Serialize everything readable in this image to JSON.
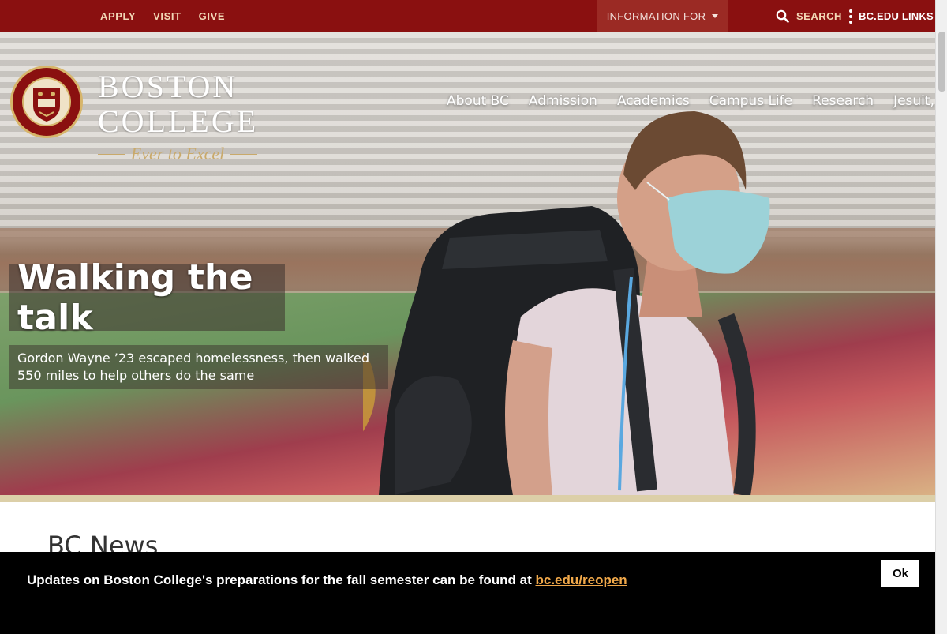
{
  "topbar": {
    "links": [
      "APPLY",
      "VISIT",
      "GIVE"
    ],
    "info_for": "INFORMATION FOR",
    "search": "SEARCH",
    "bc_links": "BC.EDU LINKS"
  },
  "brand": {
    "line1": "BOSTON",
    "line2": "COLLEGE",
    "motto": "Ever to Excel",
    "seal_text": "COLLEGIUM BOSTONIENSE FUND MDCCCLXIII"
  },
  "nav": [
    "About BC",
    "Admission",
    "Academics",
    "Campus Life",
    "Research",
    "Jesuit, Catholic"
  ],
  "hero": {
    "title": "Walking the talk",
    "subtitle": "Gordon Wayne ’23 escaped homelessness, then walked 550 miles to help others do the same"
  },
  "section": {
    "heading": "BC News"
  },
  "notice": {
    "text": "Updates on Boston College's preparations for the fall semester can be found at ",
    "link": "bc.edu/reopen",
    "ok": "Ok"
  },
  "colors": {
    "maroon": "#8a1010",
    "gold": "#dccfa8",
    "link_orange": "#f0a84a"
  }
}
